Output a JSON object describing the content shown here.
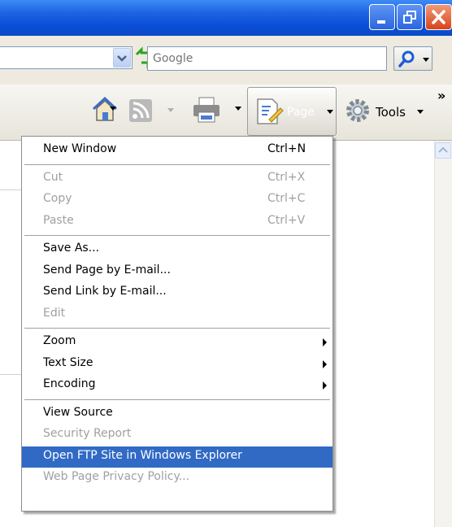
{
  "search": {
    "placeholder": "Google"
  },
  "commandbar": {
    "page_label": "Page",
    "tools_label": "Tools",
    "overflow_label": "»"
  },
  "menu": {
    "groups": [
      [
        {
          "label": "New Window",
          "shortcut": "Ctrl+N",
          "enabled": true
        }
      ],
      [
        {
          "label": "Cut",
          "shortcut": "Ctrl+X",
          "enabled": false
        },
        {
          "label": "Copy",
          "shortcut": "Ctrl+C",
          "enabled": false
        },
        {
          "label": "Paste",
          "shortcut": "Ctrl+V",
          "enabled": false
        }
      ],
      [
        {
          "label": "Save As...",
          "shortcut": "",
          "enabled": true
        },
        {
          "label": "Send Page by E-mail...",
          "shortcut": "",
          "enabled": true
        },
        {
          "label": "Send Link by E-mail...",
          "shortcut": "",
          "enabled": true
        },
        {
          "label": "Edit",
          "shortcut": "",
          "enabled": false
        }
      ],
      [
        {
          "label": "Zoom",
          "submenu": true,
          "enabled": true
        },
        {
          "label": "Text Size",
          "submenu": true,
          "enabled": true
        },
        {
          "label": "Encoding",
          "submenu": true,
          "enabled": true
        }
      ],
      [
        {
          "label": "View Source",
          "enabled": true
        },
        {
          "label": "Security Report",
          "enabled": false
        },
        {
          "label": "Open FTP Site in Windows Explorer",
          "enabled": true,
          "highlighted": true
        },
        {
          "label": "Web Page Privacy Policy...",
          "enabled": false
        }
      ]
    ]
  },
  "colors": {
    "highlight": "#316ac5",
    "disabled_text": "#a0a0a0",
    "titlebar": "#0b4fd6",
    "close_button": "#d9431a"
  },
  "icons": [
    "minimize-icon",
    "restore-icon",
    "close-icon",
    "dropdown-arrow-icon",
    "refresh-icon",
    "stop-icon",
    "search-icon",
    "home-icon",
    "feeds-icon",
    "print-icon",
    "page-icon",
    "tools-gear-icon",
    "submenu-arrow-icon"
  ]
}
